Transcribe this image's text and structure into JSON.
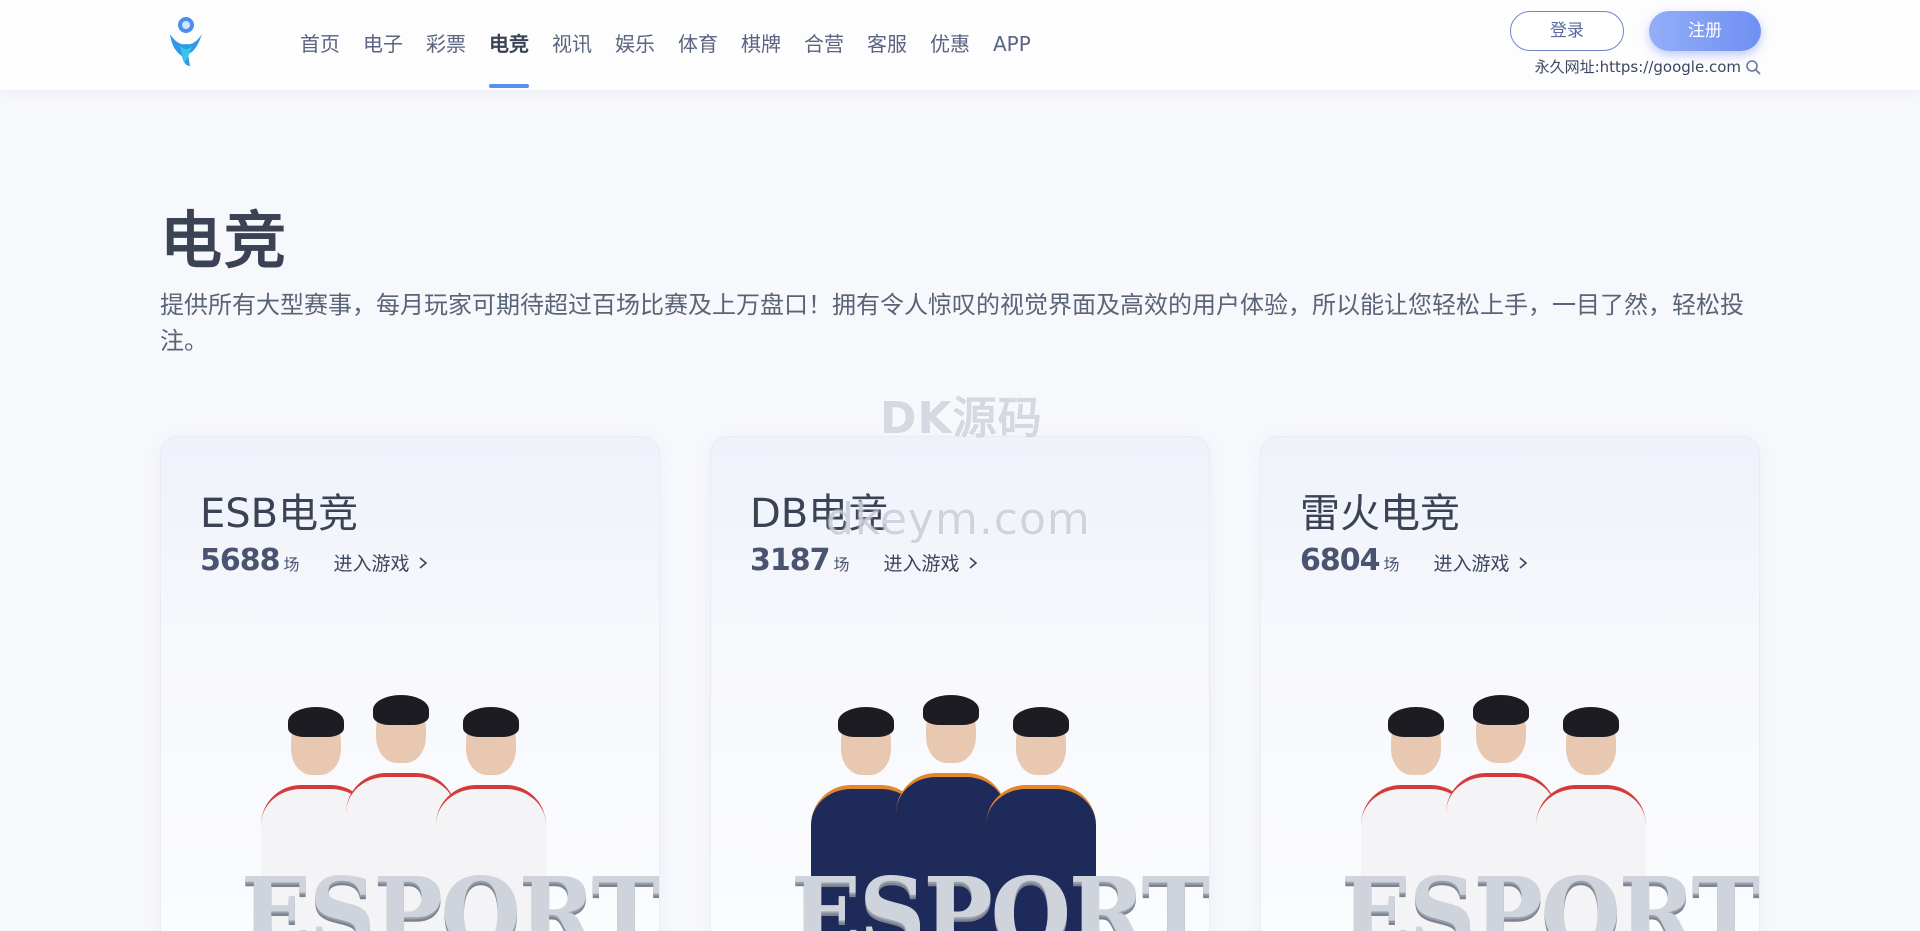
{
  "nav": {
    "items": [
      {
        "label": "首页",
        "active": false
      },
      {
        "label": "电子",
        "active": false
      },
      {
        "label": "彩票",
        "active": false
      },
      {
        "label": "电竞",
        "active": true
      },
      {
        "label": "视讯",
        "active": false
      },
      {
        "label": "娱乐",
        "active": false
      },
      {
        "label": "体育",
        "active": false
      },
      {
        "label": "棋牌",
        "active": false
      },
      {
        "label": "合营",
        "active": false
      },
      {
        "label": "客服",
        "active": false
      },
      {
        "label": "优惠",
        "active": false
      },
      {
        "label": "APP",
        "active": false
      }
    ],
    "accent_color": "#5b8ef0"
  },
  "header": {
    "login_label": "登录",
    "register_label": "注册",
    "perm_url_text": "永久网址:https://google.com",
    "search_icon": "search-icon",
    "logo_icon": "brand-logo"
  },
  "section": {
    "title": "电竞",
    "description": "提供所有大型赛事，每月玩家可期待超过百场比赛及上万盘口！拥有令人惊叹的视觉界面及高效的用户体验，所以能让您轻松上手，一目了然，轻松投注。"
  },
  "watermark": {
    "line1": "DK源码",
    "line2": "dkeym.com"
  },
  "cards": [
    {
      "title": "ESB电竞",
      "count": "5688",
      "unit": "场",
      "enter_label": "进入游戏",
      "jersey": "white",
      "banner": "ESPORTS"
    },
    {
      "title": "DB电竞",
      "count": "3187",
      "unit": "场",
      "enter_label": "进入游戏",
      "jersey": "navy",
      "banner": "ESPORTS"
    },
    {
      "title": "雷火电竞",
      "count": "6804",
      "unit": "场",
      "enter_label": "进入游戏",
      "jersey": "white",
      "banner": "ESPORTS"
    }
  ]
}
